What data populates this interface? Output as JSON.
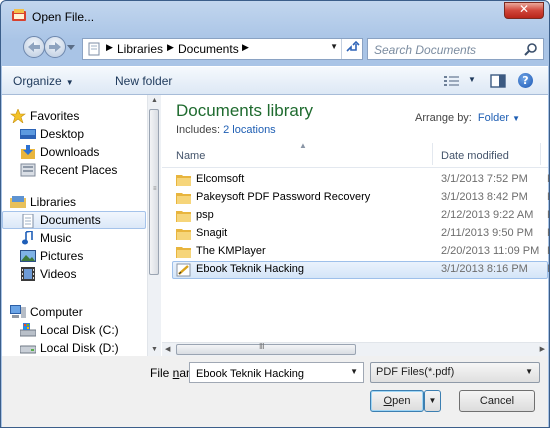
{
  "window": {
    "title": "Open File...",
    "close_glyph": "✕"
  },
  "address": {
    "crumbs": [
      "Libraries",
      "Documents"
    ]
  },
  "search": {
    "placeholder": "Search Documents"
  },
  "toolbar": {
    "organize": "Organize",
    "new_folder": "New folder"
  },
  "sidebar": {
    "favorites": {
      "label": "Favorites",
      "items": [
        "Desktop",
        "Downloads",
        "Recent Places"
      ]
    },
    "libraries": {
      "label": "Libraries",
      "items": [
        "Documents",
        "Music",
        "Pictures",
        "Videos"
      ]
    },
    "computer": {
      "label": "Computer",
      "items": [
        "Local Disk (C:)",
        "Local Disk (D:)"
      ]
    },
    "selected": "Documents"
  },
  "library": {
    "title": "Documents library",
    "includes_prefix": "Includes:",
    "includes_link": "2 locations",
    "arrange_label": "Arrange by:",
    "arrange_value": "Folder"
  },
  "columns": {
    "name": "Name",
    "date": "Date modified"
  },
  "files": [
    {
      "name": "Elcomsoft",
      "date": "3/1/2013 7:52 PM",
      "type_initial": "F",
      "kind": "folder"
    },
    {
      "name": "Pakeysoft PDF Password Recovery",
      "date": "3/1/2013 8:42 PM",
      "type_initial": "F",
      "kind": "folder"
    },
    {
      "name": "psp",
      "date": "2/12/2013 9:22 AM",
      "type_initial": "F",
      "kind": "folder"
    },
    {
      "name": "Snagit",
      "date": "2/11/2013 9:50 PM",
      "type_initial": "F",
      "kind": "folder"
    },
    {
      "name": "The KMPlayer",
      "date": "2/20/2013 11:09 PM",
      "type_initial": "F",
      "kind": "folder"
    },
    {
      "name": "Ebook Teknik Hacking",
      "date": "3/1/2013 8:16 PM",
      "type_initial": "F",
      "kind": "pdf",
      "selected": true
    }
  ],
  "footer": {
    "file_name_label_prefix": "File ",
    "file_name_label_underlined": "n",
    "file_name_label_suffix": "ame:",
    "file_name_value": "Ebook Teknik Hacking",
    "file_type": "PDF Files(*.pdf)",
    "open_underlined": "O",
    "open_rest": "pen",
    "cancel": "Cancel"
  },
  "colors": {
    "accent": "#1e5eb3",
    "library_title": "#1f6b2f",
    "selection": "#d4e5f8"
  }
}
